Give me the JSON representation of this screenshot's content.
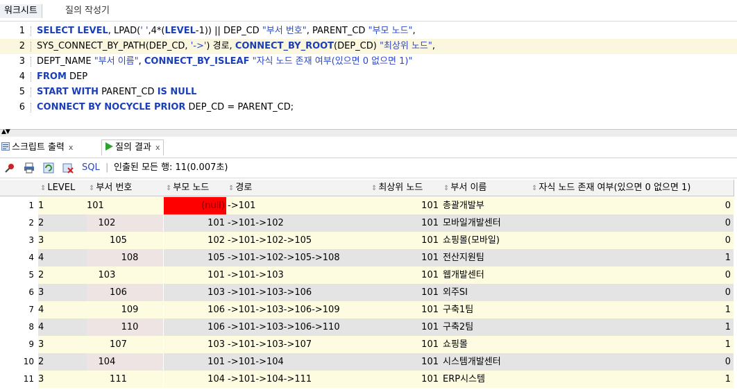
{
  "top_tabs": [
    "워크시트",
    "질의 작성기"
  ],
  "editor": {
    "lines": [
      {
        "num": "1",
        "tokens": [
          {
            "t": "SELECT LEVEL",
            "c": "kw"
          },
          {
            "t": ", LPAD(",
            "c": "plain"
          },
          {
            "t": "' '",
            "c": "str"
          },
          {
            "t": ",4*(",
            "c": "plain"
          },
          {
            "t": "LEVEL",
            "c": "kw"
          },
          {
            "t": "-1)) || DEP_CD ",
            "c": "plain"
          },
          {
            "t": "\"부서 번호\"",
            "c": "str"
          },
          {
            "t": ", PARENT_CD ",
            "c": "plain"
          },
          {
            "t": "\"부모 노드\"",
            "c": "str"
          },
          {
            "t": ",",
            "c": "plain"
          }
        ]
      },
      {
        "num": "2",
        "highlight": true,
        "tokens": [
          {
            "t": "SYS_CONNECT_BY_PATH(DEP_CD, ",
            "c": "plain"
          },
          {
            "t": "'->'",
            "c": "str"
          },
          {
            "t": ") 경로, ",
            "c": "plain"
          },
          {
            "t": "CONNECT_BY_ROOT",
            "c": "kw"
          },
          {
            "t": "(DEP_CD) ",
            "c": "plain"
          },
          {
            "t": "\"최상위 노드\"",
            "c": "str"
          },
          {
            "t": ",",
            "c": "plain"
          }
        ]
      },
      {
        "num": "3",
        "tokens": [
          {
            "t": "DEPT_NAME ",
            "c": "plain"
          },
          {
            "t": "\"부서 이름\"",
            "c": "str"
          },
          {
            "t": ", ",
            "c": "plain"
          },
          {
            "t": "CONNECT_BY_ISLEAF",
            "c": "kw"
          },
          {
            "t": " ",
            "c": "plain"
          },
          {
            "t": "\"자식 노드 존재 여부(있으면 0 없으면 1)\"",
            "c": "str"
          }
        ]
      },
      {
        "num": "4",
        "tokens": [
          {
            "t": "FROM",
            "c": "kw"
          },
          {
            "t": " DEP",
            "c": "plain"
          }
        ]
      },
      {
        "num": "5",
        "tokens": [
          {
            "t": "START WITH",
            "c": "kw"
          },
          {
            "t": " PARENT_CD ",
            "c": "plain"
          },
          {
            "t": "IS NULL",
            "c": "kw"
          }
        ]
      },
      {
        "num": "6",
        "tokens": [
          {
            "t": "CONNECT BY NOCYCLE PRIOR",
            "c": "kw"
          },
          {
            "t": " DEP_CD = PARENT_CD;",
            "c": "plain"
          }
        ]
      }
    ]
  },
  "result_tabs": {
    "script_output": "스크립트 출력",
    "query_result": "질의 결과",
    "close": "x"
  },
  "toolbar": {
    "sql": "SQL",
    "separator": "|",
    "status": "인출된 모든 행: 11(0.007초)"
  },
  "columns": {
    "level": "LEVEL",
    "dep": "부서 번호",
    "parent": "부모 노드",
    "path": "경로",
    "root": "최상위 노드",
    "name": "부서 이름",
    "leaf": "자식 노드 존재 여부(있으면 0 없으면 1)"
  },
  "sort_icon": "⇕",
  "rows": [
    {
      "n": "1",
      "level": "1",
      "dep": "101",
      "parent": "(null)",
      "path": "->101",
      "root": "101",
      "name": "총괄개발부",
      "leaf": "0"
    },
    {
      "n": "2",
      "level": "2",
      "dep": "    102",
      "parent": "101",
      "path": "->101->102",
      "root": "101",
      "name": "모바일개발센터",
      "leaf": "0"
    },
    {
      "n": "3",
      "level": "3",
      "dep": "        105",
      "parent": "102",
      "path": "->101->102->105",
      "root": "101",
      "name": "쇼핑몰(모바일)",
      "leaf": "0"
    },
    {
      "n": "4",
      "level": "4",
      "dep": "            108",
      "parent": "105",
      "path": "->101->102->105->108",
      "root": "101",
      "name": "전산지원팀",
      "leaf": "1"
    },
    {
      "n": "5",
      "level": "2",
      "dep": "    103",
      "parent": "101",
      "path": "->101->103",
      "root": "101",
      "name": "웹개발센터",
      "leaf": "0"
    },
    {
      "n": "6",
      "level": "3",
      "dep": "        106",
      "parent": "103",
      "path": "->101->103->106",
      "root": "101",
      "name": "외주SI",
      "leaf": "0"
    },
    {
      "n": "7",
      "level": "4",
      "dep": "            109",
      "parent": "106",
      "path": "->101->103->106->109",
      "root": "101",
      "name": "구축1팀",
      "leaf": "1"
    },
    {
      "n": "8",
      "level": "4",
      "dep": "            110",
      "parent": "106",
      "path": "->101->103->106->110",
      "root": "101",
      "name": "구축2팀",
      "leaf": "1"
    },
    {
      "n": "9",
      "level": "3",
      "dep": "        107",
      "parent": "103",
      "path": "->101->103->107",
      "root": "101",
      "name": "쇼핑몰",
      "leaf": "1"
    },
    {
      "n": "10",
      "level": "2",
      "dep": "    104",
      "parent": "101",
      "path": "->101->104",
      "root": "101",
      "name": "시스템개발센터",
      "leaf": "0"
    },
    {
      "n": "11",
      "level": "3",
      "dep": "        111",
      "parent": "104",
      "path": "->101->104->111",
      "root": "101",
      "name": "ERP시스템",
      "leaf": "1"
    }
  ],
  "colors": {
    "null_cell": "#ff0000",
    "keyword": "#1a3fb6",
    "row_yellow": "#fdfbe0",
    "row_gray": "#e4e4e4"
  }
}
